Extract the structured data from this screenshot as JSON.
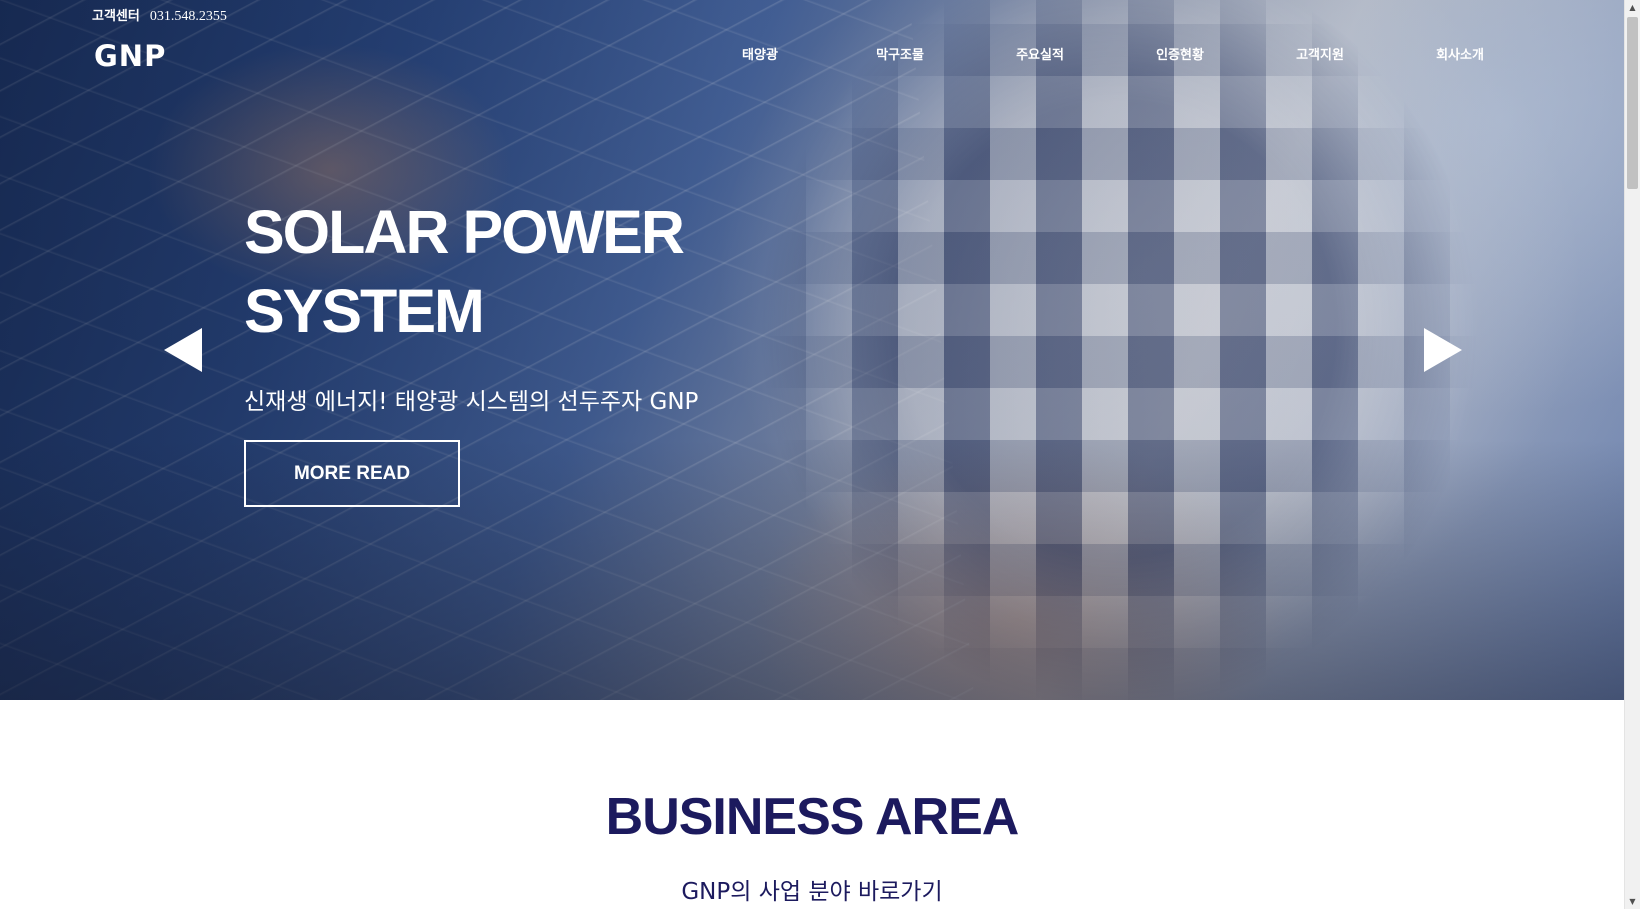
{
  "top_bar": {
    "customer_center_label": "고객센터",
    "phone": "031.548.2355"
  },
  "logo": {
    "text": "GNP"
  },
  "nav": {
    "items": [
      {
        "label": "태양광"
      },
      {
        "label": "막구조물"
      },
      {
        "label": "주요실적"
      },
      {
        "label": "인증현황"
      },
      {
        "label": "고객지원"
      },
      {
        "label": "회사소개"
      }
    ]
  },
  "hero": {
    "title_line1": "SOLAR POWER",
    "title_line2": "SYSTEM",
    "subtitle": "신재생 에너지! 태양광 시스템의 선두주자 GNP",
    "button_label": "MORE READ",
    "prev_icon": "triangle-left",
    "next_icon": "triangle-right"
  },
  "business_area": {
    "title": "BUSINESS AREA",
    "subtitle": "GNP의 사업 분야 바로가기"
  },
  "colors": {
    "accent_navy": "#1c1a5e",
    "hero_text": "#ffffff"
  },
  "scrollbar": {
    "up_icon": "▲",
    "down_icon": "▼"
  }
}
